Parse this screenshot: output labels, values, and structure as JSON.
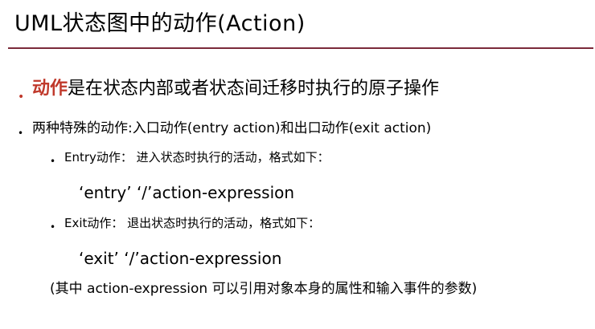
{
  "title": "UML状态图中的动作(Action)",
  "bullets": {
    "b1_highlight": "动作",
    "b1_rest": "是在状态内部或者状态间迁移时执行的原子操作",
    "b2": "两种特殊的动作:入口动作(entry action)和出口动作(exit action)",
    "entry_line": "Entry动作： 进入状态时执行的活动，格式如下：",
    "entry_expr": "‘entry’  ‘/’action-expression",
    "exit_line": "Exit动作： 退出状态时执行的活动，格式如下：",
    "exit_expr": "‘exit’  ‘/’action-expression",
    "note": "(其中 action-expression 可以引用对象本身的属性和输入事件的参数)"
  },
  "bullet_glyph": "•",
  "colors": {
    "title_rule": "#7b2a3a",
    "highlight": "#c0392b"
  }
}
